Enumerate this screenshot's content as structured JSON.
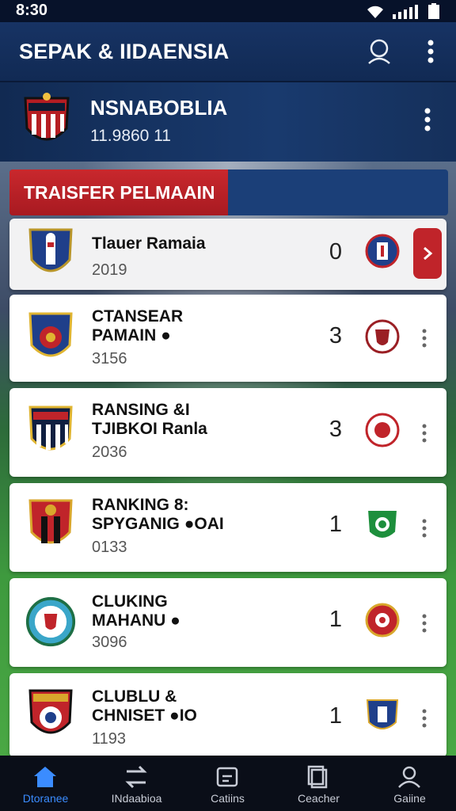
{
  "status_bar": {
    "time": "8:30"
  },
  "app_bar": {
    "title": "SEPAK & IIDAENSIA",
    "search_icon": "search-icon",
    "more_icon": "more-vert-icon"
  },
  "team_header": {
    "name": "NSNABOBLIA",
    "subtitle": "11.9860 11"
  },
  "section": {
    "label": "TRAISFER PELMAAIN"
  },
  "transfers": [
    {
      "name": "Tlauer Ramaia",
      "year": "2019",
      "score": "0"
    },
    {
      "name": "CTANSEAR\nPAMAIN ●",
      "year": "3156",
      "score": "3"
    },
    {
      "name": "RANSING &I\nTJIBKOI Ranla",
      "year": "2036",
      "score": "3"
    },
    {
      "name": "RANKING 8:\nSPYGANIG ●OAI",
      "year": "0133",
      "score": "1"
    },
    {
      "name": "CLUKING\nMAHANU ●",
      "year": "3096",
      "score": "1"
    },
    {
      "name": "CLUBLU &\nCHNISET ●IO",
      "year": "1193",
      "score": "1"
    }
  ],
  "bottom_nav": [
    {
      "label": "Dtoranee",
      "active": true
    },
    {
      "label": "INdaabioa"
    },
    {
      "label": "Catiins"
    },
    {
      "label": "Ceacher"
    },
    {
      "label": "Gaiine"
    }
  ],
  "colors": {
    "accent": "#c0242a",
    "header": "#173364",
    "nav_active": "#3b8cff"
  }
}
